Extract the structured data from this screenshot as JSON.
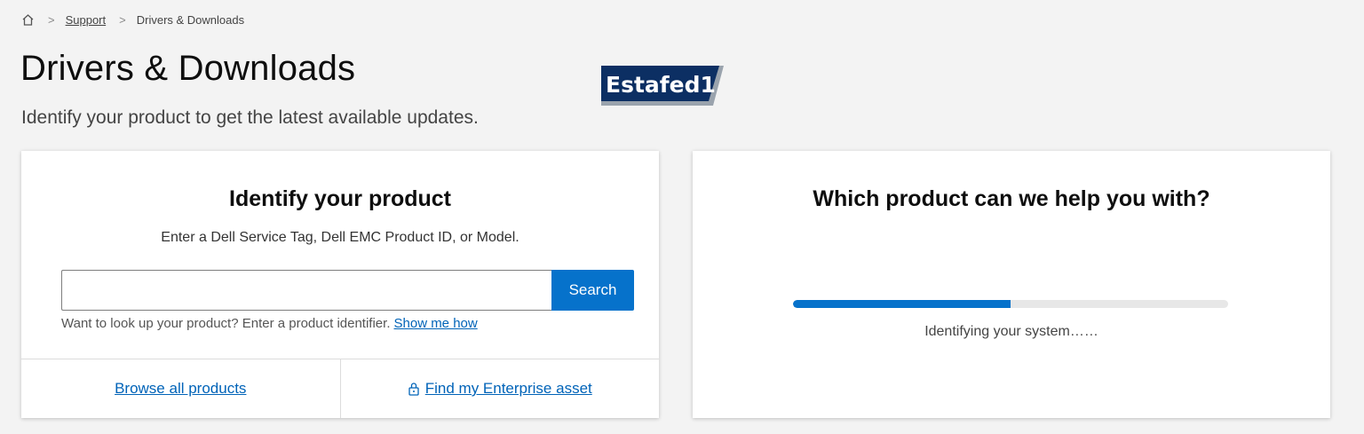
{
  "breadcrumb": {
    "home_icon": "home-icon",
    "separator": ">",
    "items": [
      {
        "label": "Support"
      },
      {
        "label": "Drivers & Downloads"
      }
    ]
  },
  "header": {
    "title": "Drivers & Downloads",
    "subtitle": "Identify your product to get the latest available updates.",
    "logo_text": "Estafed1"
  },
  "identify_card": {
    "title": "Identify your product",
    "description": "Enter a Dell Service Tag, Dell EMC Product ID, or Model.",
    "search": {
      "value": "",
      "placeholder": "",
      "button_label": "Search"
    },
    "helper_text": "Want to look up your product? Enter a product identifier.",
    "helper_link": "Show me how",
    "footer": {
      "browse_label": "Browse all products",
      "enterprise_label": "Find my Enterprise asset",
      "enterprise_icon": "lock-icon"
    }
  },
  "help_card": {
    "title": "Which product can we help you with?",
    "progress": 0.5,
    "status": "Identifying your system……"
  },
  "colors": {
    "accent": "#0672cb",
    "link": "#0063b8",
    "background": "#f3f3f3",
    "progress_track": "#e7e7e7"
  }
}
